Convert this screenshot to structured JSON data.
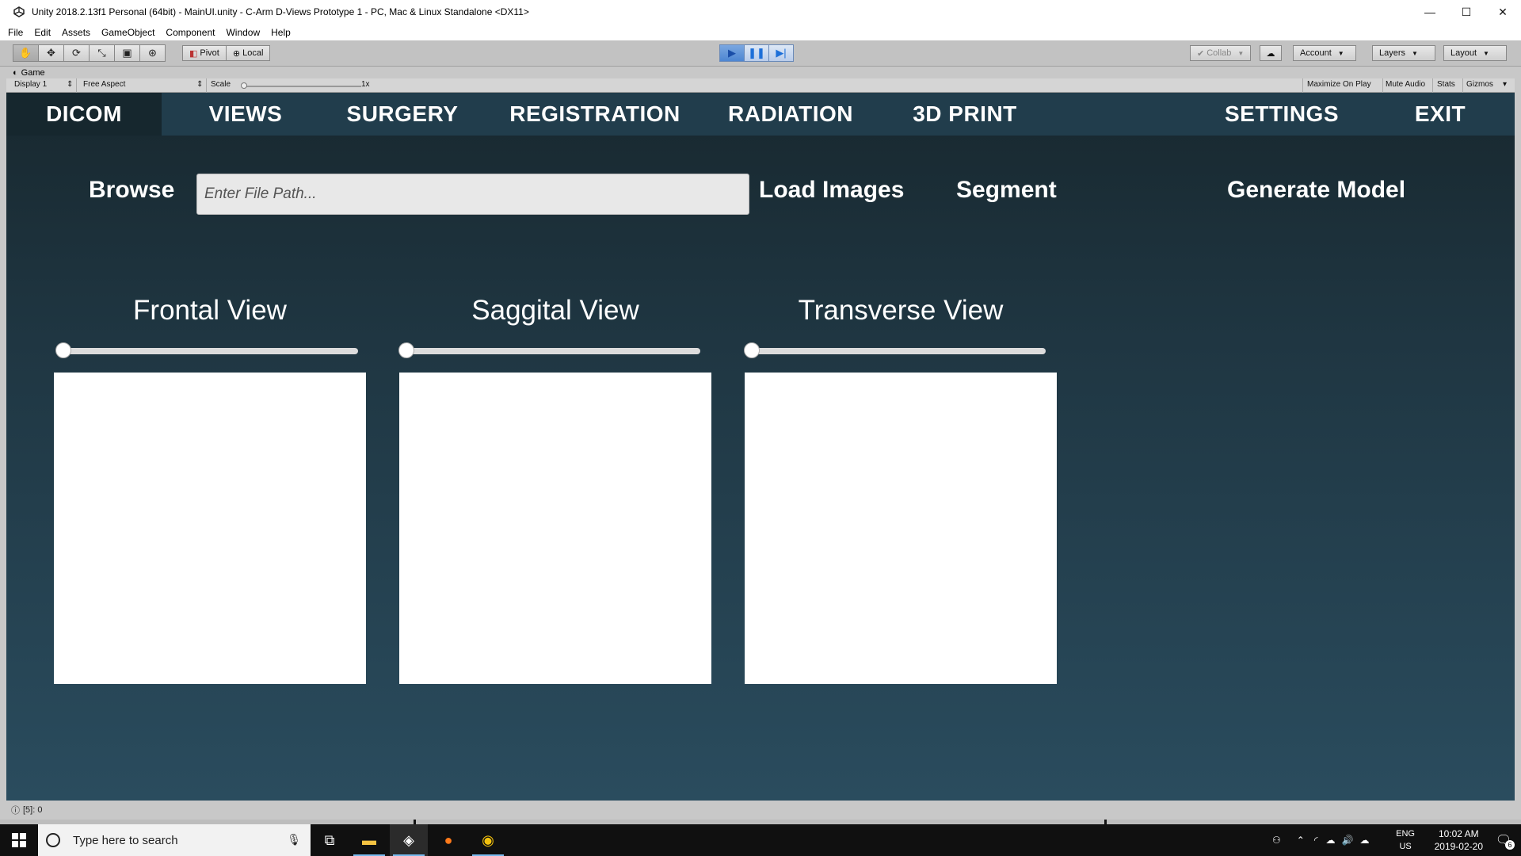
{
  "window": {
    "title": "Unity 2018.2.13f1 Personal (64bit) - MainUI.unity - C-Arm D-Views Prototype 1 - PC, Mac & Linux Standalone <DX11>",
    "minimize": "—",
    "maximize": "☐",
    "close": "✕"
  },
  "menu": [
    "File",
    "Edit",
    "Assets",
    "GameObject",
    "Component",
    "Window",
    "Help"
  ],
  "toolbar": {
    "pivot": "Pivot",
    "local": "Local",
    "collab": "Collab",
    "account": "Account",
    "layers": "Layers",
    "layout": "Layout"
  },
  "game_view": {
    "tab": "Game",
    "display": "Display 1",
    "aspect": "Free Aspect",
    "scale_label": "Scale",
    "scale_value": "1x",
    "maximize_on_play": "Maximize On Play",
    "mute_audio": "Mute Audio",
    "stats": "Stats",
    "gizmos": "Gizmos"
  },
  "app": {
    "nav": [
      "DICOM",
      "VIEWS",
      "SURGERY",
      "REGISTRATION",
      "RADIATION",
      "3D PRINT",
      "SETTINGS",
      "EXIT"
    ],
    "active_tab": "DICOM",
    "browse": "Browse",
    "file_path_placeholder": "Enter File Path...",
    "load_images": "Load Images",
    "segment": "Segment",
    "generate_model": "Generate Model",
    "views": [
      {
        "title": "Frontal View",
        "slider_value": 0
      },
      {
        "title": "Saggital View",
        "slider_value": 0
      },
      {
        "title": "Transverse View",
        "slider_value": 0
      }
    ]
  },
  "status": {
    "text": "[5]: 0"
  },
  "taskbar": {
    "search_placeholder": "Type here to search",
    "lang_top": "ENG",
    "lang_bottom": "US",
    "time": "10:02 AM",
    "date": "2019-02-20",
    "notifications": "6"
  }
}
